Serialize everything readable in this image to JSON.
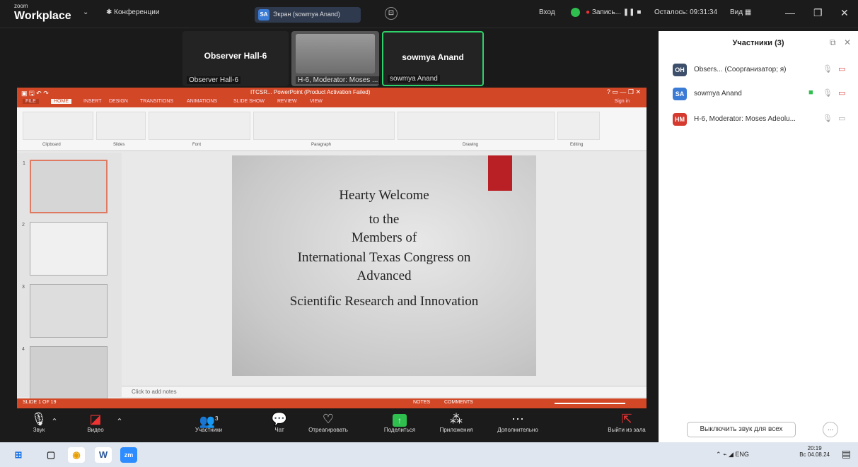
{
  "top_bar": {
    "logo_small": "zoom",
    "logo": "Workplace",
    "meetings_label": "Конференции",
    "screen_share_label": "Экран (sowmya Anand)",
    "screen_share_avatar": "SA",
    "login_label": "Вход",
    "recording_label": "Запись...",
    "remaining_label": "Осталось: 09:31:34",
    "view_label": "Вид"
  },
  "video_tiles": [
    {
      "name": "Observer Hall-6",
      "caption": "Observer Hall-6"
    },
    {
      "name": "",
      "caption": "H-6, Moderator: Moses ..."
    },
    {
      "name": "sowmya Anand",
      "caption": "sowmya Anand"
    }
  ],
  "ppt": {
    "title": "ITCSR... PowerPoint (Product Activation Failed)",
    "tabs": [
      "FILE",
      "HOME",
      "INSERT",
      "DESIGN",
      "TRANSITIONS",
      "ANIMATIONS",
      "SLIDE SHOW",
      "REVIEW",
      "VIEW"
    ],
    "sign_in": "Sign in",
    "ribbon_groups": [
      "Clipboard",
      "Slides",
      "Font",
      "Paragraph",
      "Drawing",
      "Editing"
    ],
    "notes_placeholder": "Click to add notes",
    "status_left": "SLIDE 1 OF 19",
    "status_notes": "NOTES",
    "status_comments": "COMMENTS",
    "slide_lines": [
      "Hearty Welcome",
      "to the",
      "Members of",
      "International Texas Congress on",
      "Advanced",
      "Scientific Research and Innovation"
    ],
    "thumb_numbers": [
      "1",
      "2",
      "3",
      "4"
    ]
  },
  "panel": {
    "title": "Участники (3)",
    "participants": [
      {
        "initials": "OH",
        "color": "#3d4f6b",
        "name": "Obsers... (Соорганизатор; я)"
      },
      {
        "initials": "SA",
        "color": "#3a7bd5",
        "name": "sowmya Anand"
      },
      {
        "initials": "HM",
        "color": "#d63a2f",
        "name": "H-6, Moderator: Moses Adeolu..."
      }
    ],
    "mute_all": "Выключить звук для всех",
    "more": "..."
  },
  "toolbar": {
    "audio": "Звук",
    "video": "Видео",
    "participants": "Участники",
    "participants_count": "3",
    "chat": "Чат",
    "react": "Отреагировать",
    "share": "Поделиться",
    "apps": "Приложения",
    "more": "Дополнительно",
    "leave": "Выйти из зала"
  },
  "taskbar": {
    "lang": "ENG",
    "time": "20:19",
    "date": "Вс 04.08.24"
  }
}
